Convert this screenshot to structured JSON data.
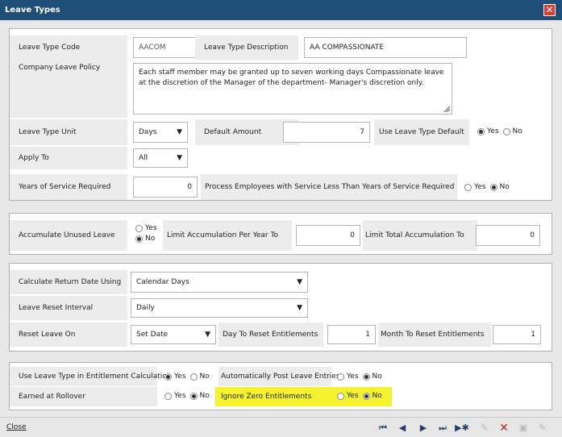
{
  "window": {
    "title": "Leave Types"
  },
  "section1": {
    "leave_type_code_label": "Leave Type Code",
    "leave_type_code_value": "AACOM",
    "leave_type_desc_label": "Leave Type Description",
    "leave_type_desc_value": "AA COMPASSIONATE",
    "policy_label": "Company Leave Policy",
    "policy_value": "Each staff member may be granted up to seven working days Compassionate leave at the discretion of the Manager of the department- Manager's discretion only.",
    "unit_label": "Leave Type Unit",
    "unit_value": "Days",
    "default_amount_label": "Default Amount",
    "default_amount_value": "7",
    "use_default_label": "Use Leave Type Default",
    "use_default_yes": "Yes",
    "use_default_no": "No",
    "apply_to_label": "Apply To",
    "apply_to_value": "All",
    "years_service_label": "Years of Service Required",
    "years_service_value": "0",
    "process_label": "Process Employees with Service Less Than Years of Service Required",
    "process_yes": "Yes",
    "process_no": "No"
  },
  "section2": {
    "accumulate_label": "Accumulate Unused Leave",
    "accumulate_yes": "Yes",
    "accumulate_no": "No",
    "limit_year_label": "Limit Accumulation Per Year To",
    "limit_year_value": "0",
    "limit_total_label": "Limit Total Accumulation To",
    "limit_total_value": "0"
  },
  "section3": {
    "calc_return_label": "Calculate Return Date Using",
    "calc_return_value": "Calendar Days",
    "reset_interval_label": "Leave Reset Interval",
    "reset_interval_value": "Daily",
    "reset_on_label": "Reset Leave On",
    "reset_on_value": "Set Date",
    "day_reset_label": "Day To Reset Entitlements",
    "day_reset_value": "1",
    "month_reset_label": "Month To Reset Entitlements",
    "month_reset_value": "1"
  },
  "section4": {
    "use_in_calc_label": "Use Leave Type in Entitlement Calculation",
    "use_in_calc_yes": "Yes",
    "use_in_calc_no": "No",
    "auto_post_label": "Automatically Post Leave Entries",
    "auto_post_yes": "Yes",
    "auto_post_no": "No",
    "earned_label": "Earned at Rollover",
    "earned_yes": "Yes",
    "earned_no": "No",
    "ignore_zero_label": "Ignore Zero Entitlements",
    "ignore_zero_yes": "Yes",
    "ignore_zero_no": "No"
  },
  "footer": {
    "close_label": "Close"
  },
  "colors": {
    "titlebar": "#1f4e79",
    "highlight": "#f4f22e",
    "close_button": "#e03b2e"
  }
}
